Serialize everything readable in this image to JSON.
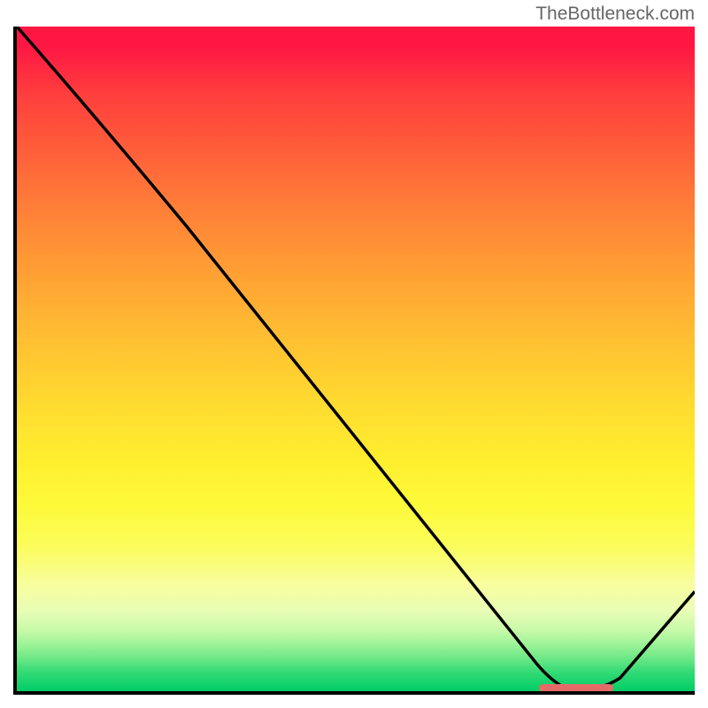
{
  "watermark": "TheBottleneck.com",
  "chart_data": {
    "type": "line",
    "title": "",
    "xlabel": "",
    "ylabel": "",
    "xlim": [
      0,
      100
    ],
    "ylim": [
      0,
      100
    ],
    "curve_points": [
      {
        "x": 0,
        "y": 100
      },
      {
        "x": 25,
        "y": 70
      },
      {
        "x": 82,
        "y": 0
      },
      {
        "x": 100,
        "y": 15
      }
    ],
    "minimum_marker": {
      "x_start": 77,
      "x_end": 88,
      "y": 0.5
    },
    "gradient_colors": {
      "top": "#ff1744",
      "middle": "#ffde30",
      "bottom": "#00cc66"
    }
  }
}
